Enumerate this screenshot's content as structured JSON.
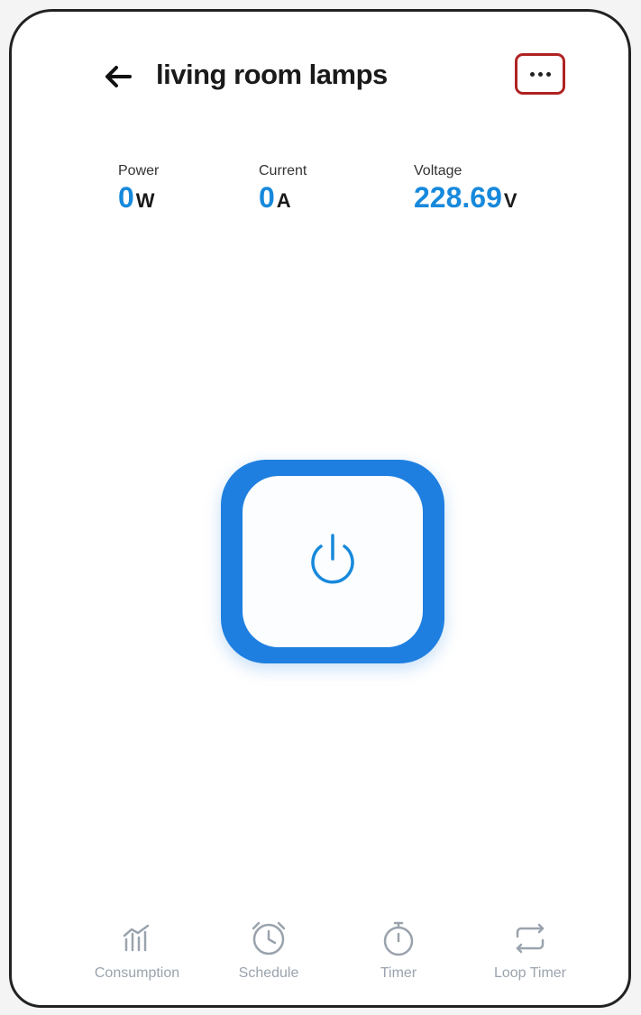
{
  "header": {
    "title": "living room lamps",
    "back_icon": "arrow-left-icon",
    "more_icon": "more-dots-icon"
  },
  "metrics": {
    "power": {
      "label": "Power",
      "value": "0",
      "unit": "W"
    },
    "current": {
      "label": "Current",
      "value": "0",
      "unit": "A"
    },
    "voltage": {
      "label": "Voltage",
      "value": "228.69",
      "unit": "V"
    }
  },
  "power_button": {
    "icon": "power-icon",
    "state": "off"
  },
  "bottom_nav": [
    {
      "label": "Consumption",
      "icon": "chart-icon"
    },
    {
      "label": "Schedule",
      "icon": "alarm-clock-icon"
    },
    {
      "label": "Timer",
      "icon": "stopwatch-icon"
    },
    {
      "label": "Loop Timer",
      "icon": "loop-icon"
    }
  ],
  "colors": {
    "accent": "#1789dc",
    "power_ring": "#1e7fe0",
    "highlight_border": "#b02222",
    "nav_inactive": "#9aa3ad"
  }
}
